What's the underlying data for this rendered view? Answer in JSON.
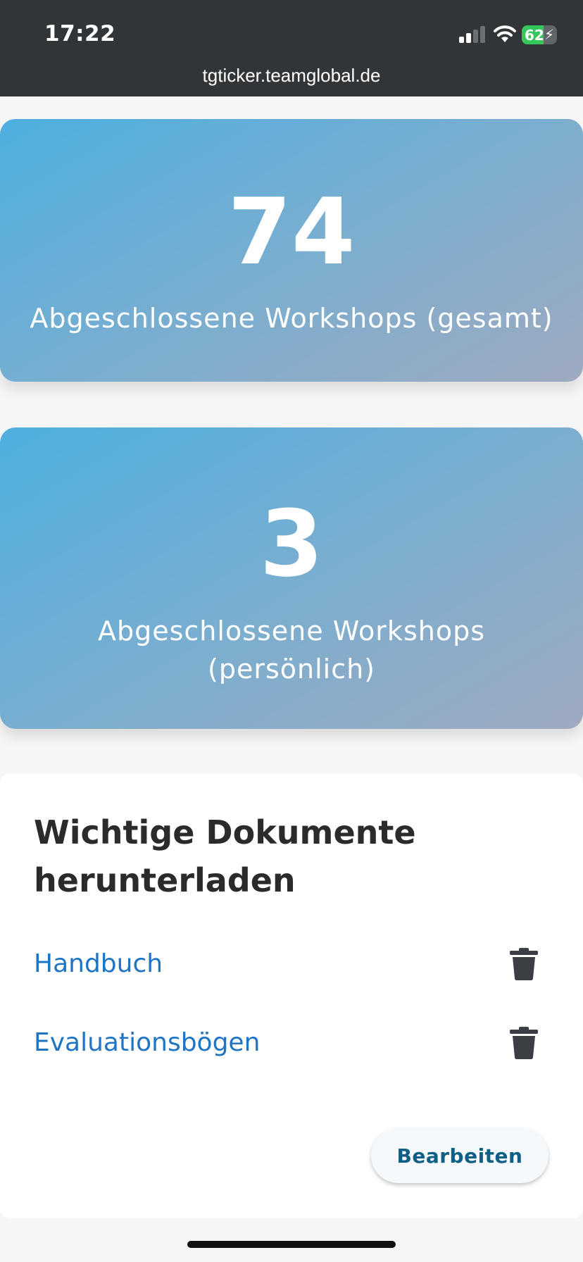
{
  "status_bar": {
    "time": "17:22",
    "battery_level": "62",
    "signal_icon": "cellular-signal-icon",
    "wifi_icon": "wifi-icon",
    "battery_icon": "battery-charging-icon"
  },
  "browser": {
    "url": "tgticker.teamglobal.de"
  },
  "stats": [
    {
      "number": "74",
      "label": "Abgeschlossene Workshops (gesamt)"
    },
    {
      "number": "3",
      "label": "Abgeschlossene Workshops (persönlich)"
    }
  ],
  "documents": {
    "title": "Wichtige Dokumente herunterladen",
    "items": [
      {
        "label": "Handbuch",
        "delete_icon": "trash-icon"
      },
      {
        "label": "Evaluationsbögen",
        "delete_icon": "trash-icon"
      }
    ],
    "edit_label": "Bearbeiten"
  },
  "colors": {
    "status_bar_bg": "#323538",
    "card_gradient_start": "#4dafe0",
    "card_gradient_end": "#9eaac0",
    "link": "#1f74c4",
    "button_text": "#0d5f86",
    "battery_fill": "#34c759"
  }
}
